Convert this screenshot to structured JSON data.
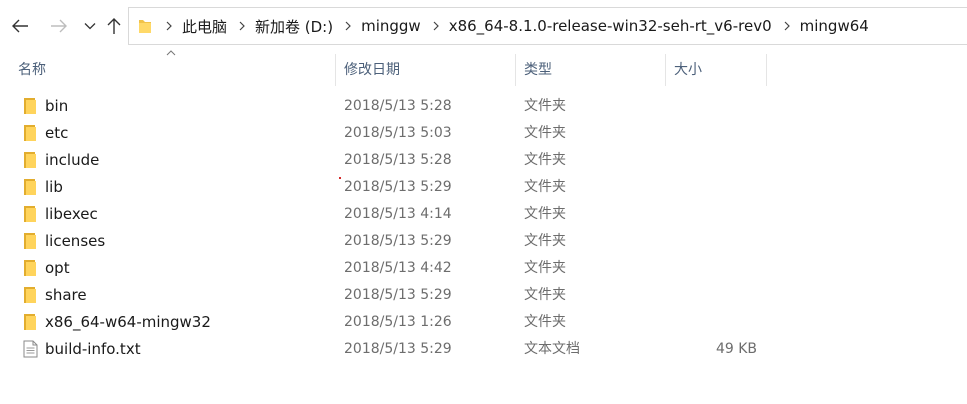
{
  "address": {
    "crumbs": [
      "此电脑",
      "新加卷 (D:)",
      "minggw",
      "x86_64-8.1.0-release-win32-seh-rt_v6-rev0",
      "mingw64"
    ]
  },
  "columns": {
    "name": "名称",
    "modified": "修改日期",
    "type": "类型",
    "size": "大小"
  },
  "files": [
    {
      "name": "bin",
      "modified": "2018/5/13 5:28",
      "type": "文件夹",
      "size": "",
      "icon": "folder-icon"
    },
    {
      "name": "etc",
      "modified": "2018/5/13 5:03",
      "type": "文件夹",
      "size": "",
      "icon": "folder-icon"
    },
    {
      "name": "include",
      "modified": "2018/5/13 5:28",
      "type": "文件夹",
      "size": "",
      "icon": "folder-icon"
    },
    {
      "name": "lib",
      "modified": "2018/5/13 5:29",
      "type": "文件夹",
      "size": "",
      "icon": "folder-icon"
    },
    {
      "name": "libexec",
      "modified": "2018/5/13 4:14",
      "type": "文件夹",
      "size": "",
      "icon": "folder-icon"
    },
    {
      "name": "licenses",
      "modified": "2018/5/13 5:29",
      "type": "文件夹",
      "size": "",
      "icon": "folder-icon"
    },
    {
      "name": "opt",
      "modified": "2018/5/13 4:42",
      "type": "文件夹",
      "size": "",
      "icon": "folder-icon"
    },
    {
      "name": "share",
      "modified": "2018/5/13 5:29",
      "type": "文件夹",
      "size": "",
      "icon": "folder-icon"
    },
    {
      "name": "x86_64-w64-mingw32",
      "modified": "2018/5/13 1:26",
      "type": "文件夹",
      "size": "",
      "icon": "folder-icon"
    },
    {
      "name": "build-info.txt",
      "modified": "2018/5/13 5:29",
      "type": "文本文档",
      "size": "49 KB",
      "icon": "text-file-icon"
    }
  ],
  "colors": {
    "folder": "#f1c34a",
    "header_text": "#4c607a",
    "dim_text": "#6d6d6d"
  }
}
